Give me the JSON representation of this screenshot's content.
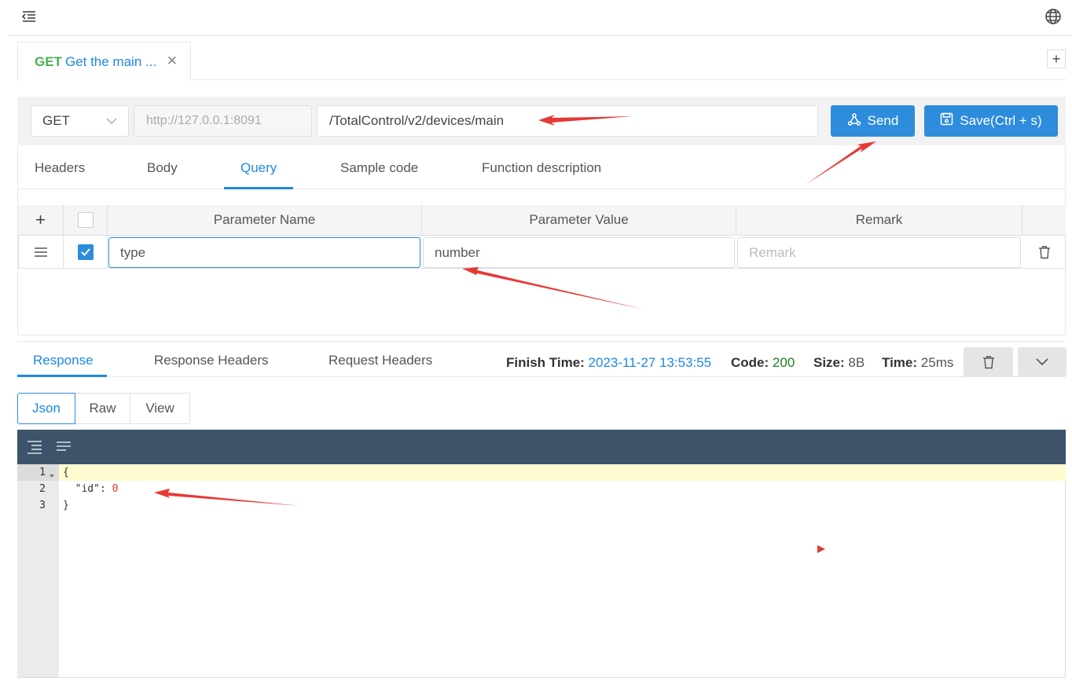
{
  "request_tab": {
    "method": "GET",
    "title": "Get the main ...",
    "add_label": "+"
  },
  "url": {
    "method": "GET",
    "host": "http://127.0.0.1:8091",
    "path": "/TotalControl/v2/devices/main"
  },
  "buttons": {
    "send": "Send",
    "save": "Save(Ctrl + s)"
  },
  "request_tabs": [
    "Headers",
    "Body",
    "Query",
    "Sample code",
    "Function description"
  ],
  "params": {
    "headers": {
      "name": "Parameter Name",
      "value": "Parameter Value",
      "remark": "Remark"
    },
    "rows": [
      {
        "checked": true,
        "name": "type",
        "value": "number",
        "remark_placeholder": "Remark"
      }
    ]
  },
  "response_tabs": [
    "Response",
    "Response Headers",
    "Request Headers"
  ],
  "stats": {
    "finish_label": "Finish Time:",
    "finish_value": "2023-11-27 13:53:55",
    "code_label": "Code:",
    "code_value": "200",
    "size_label": "Size:",
    "size_value": "8B",
    "time_label": "Time:",
    "time_value": "25ms"
  },
  "formats": [
    "Json",
    "Raw",
    "View"
  ],
  "editor": {
    "line_numbers": [
      "1",
      "2",
      "3"
    ],
    "lines": [
      "{",
      "  \"id\": ",
      "}"
    ],
    "value": "0"
  },
  "colors": {
    "accent": "#2d8cdc",
    "method_get": "#4caf50",
    "code_ok": "#1a7f1a",
    "annotation": "#e53935"
  }
}
